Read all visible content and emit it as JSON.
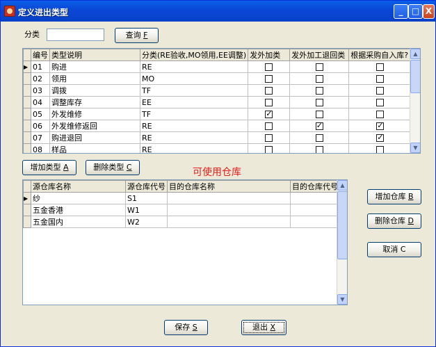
{
  "window": {
    "title": "定义进出类型",
    "controls": {
      "minimize": "_",
      "maximize": "□",
      "close": "X"
    }
  },
  "filter": {
    "label": "分类",
    "value": "",
    "query_label": "查询",
    "query_key": "F"
  },
  "types_table": {
    "columns": [
      "编号",
      "类型说明",
      "分类(RE验收,MO领用,EE调整)",
      "发外加类",
      "发外加工退回类",
      "根据采购自入库?"
    ],
    "rows": [
      {
        "code": "01",
        "desc": "购进",
        "cat": "RE",
        "c1": false,
        "c2": false,
        "c3": false
      },
      {
        "code": "02",
        "desc": "领用",
        "cat": "MO",
        "c1": false,
        "c2": false,
        "c3": false
      },
      {
        "code": "03",
        "desc": "调拨",
        "cat": "TF",
        "c1": false,
        "c2": false,
        "c3": false
      },
      {
        "code": "04",
        "desc": "调整库存",
        "cat": "EE",
        "c1": false,
        "c2": false,
        "c3": false
      },
      {
        "code": "05",
        "desc": "外发维修",
        "cat": "TF",
        "c1": true,
        "c2": false,
        "c3": false
      },
      {
        "code": "06",
        "desc": "外发维修返回",
        "cat": "RE",
        "c1": false,
        "c2": true,
        "c3": true
      },
      {
        "code": "07",
        "desc": "购进退回",
        "cat": "RE",
        "c1": false,
        "c2": false,
        "c3": true
      },
      {
        "code": "08",
        "desc": "样品",
        "cat": "RE",
        "c1": false,
        "c2": false,
        "c3": false
      }
    ]
  },
  "add_type": {
    "label": "增加类型",
    "key": "A"
  },
  "delete_type": {
    "label": "删除类型",
    "key": "C"
  },
  "warehouse_title": "可使用仓库",
  "warehouse_table": {
    "columns": [
      "源仓库名称",
      "源仓库代号",
      "目的仓库名称",
      "目的仓库代号"
    ],
    "rows": [
      {
        "src_name": "纱",
        "src_code": "S1",
        "dst_name": "",
        "dst_code": ""
      },
      {
        "src_name": "五金香港",
        "src_code": "W1",
        "dst_name": "",
        "dst_code": ""
      },
      {
        "src_name": "五金国内",
        "src_code": "W2",
        "dst_name": "",
        "dst_code": ""
      }
    ]
  },
  "add_warehouse": {
    "label": "增加仓库",
    "key": "B"
  },
  "delete_warehouse": {
    "label": "删除仓库",
    "key": "D"
  },
  "cancel": {
    "label": "取消",
    "key": "C"
  },
  "save": {
    "label": "保存",
    "key": "S"
  },
  "exit": {
    "label": "退出",
    "key": "X"
  }
}
